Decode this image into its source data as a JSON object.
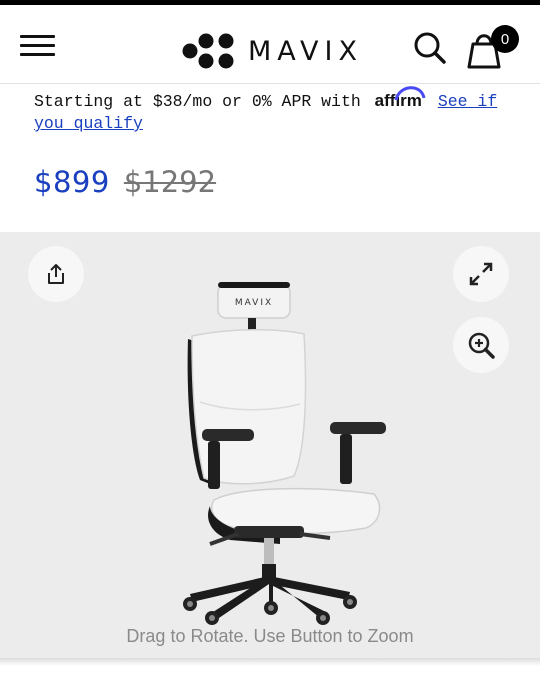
{
  "header": {
    "brand_name": "MAVIX",
    "icons": [
      "hamburger-menu-icon",
      "search-icon",
      "shopping-bag-icon"
    ],
    "cart_count": "0"
  },
  "financing": {
    "text": "Starting at $38/mo or 0% APR with",
    "affirm_logo": "affirm",
    "link_text": "See if you qualify"
  },
  "price": {
    "current": "$899",
    "original": "$1292",
    "accent_color": "#1a3fbf"
  },
  "viewer": {
    "caption": "Drag to Rotate. Use Button to Zoom",
    "chair_brand": "MAVIX",
    "buttons": [
      "share-icon",
      "expand-icon",
      "zoom-in-icon"
    ],
    "background": "#ececec"
  }
}
